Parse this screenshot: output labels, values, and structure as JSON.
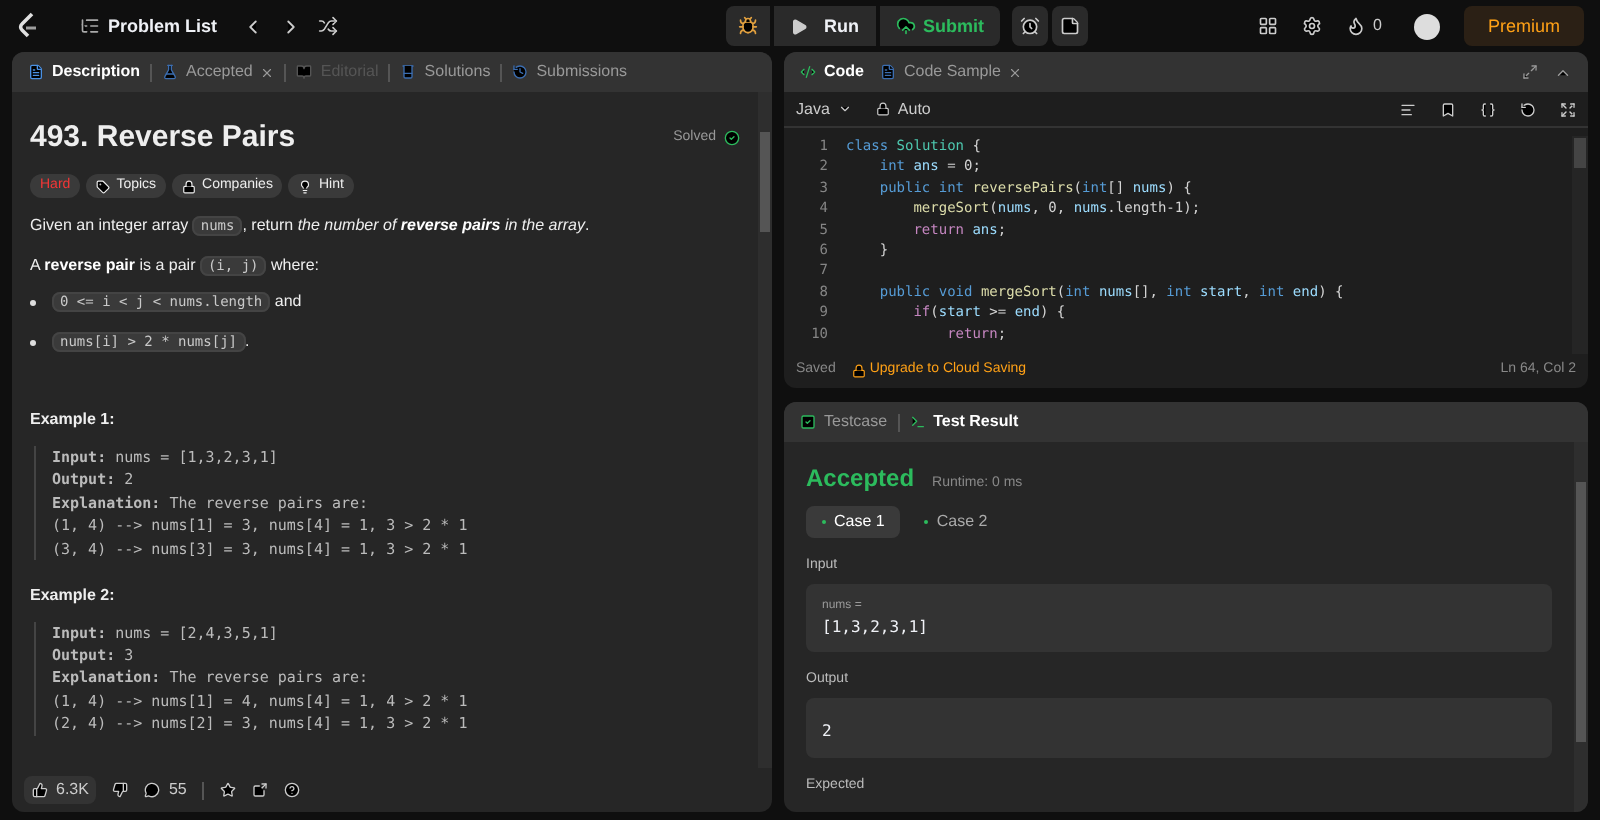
{
  "topbar": {
    "problem_list": "Problem List",
    "run": "Run",
    "submit": "Submit",
    "streak": "0",
    "premium": "Premium"
  },
  "description_panel": {
    "tabs": [
      {
        "label": "Description",
        "selected": true,
        "closable": false,
        "disabled": false
      },
      {
        "label": "Accepted",
        "selected": false,
        "closable": true,
        "disabled": false
      },
      {
        "label": "Editorial",
        "selected": false,
        "closable": false,
        "disabled": true
      },
      {
        "label": "Solutions",
        "selected": false,
        "closable": false,
        "disabled": false
      },
      {
        "label": "Submissions",
        "selected": false,
        "closable": false,
        "disabled": false
      }
    ],
    "title": "493. Reverse Pairs",
    "status": "Solved",
    "difficulty": "Hard",
    "chips": [
      "Topics",
      "Companies",
      "Hint"
    ],
    "paragraphs": [
      [
        {
          "kind": "text",
          "text": "Given an integer array "
        },
        {
          "kind": "code",
          "text": "nums"
        },
        {
          "kind": "text",
          "text": ", return "
        },
        {
          "kind": "italic",
          "text": "the number of "
        },
        {
          "kind": "bolditalic",
          "text": "reverse pairs"
        },
        {
          "kind": "italic",
          "text": " in the array"
        },
        {
          "kind": "text",
          "text": "."
        }
      ],
      [
        {
          "kind": "text",
          "text": "A "
        },
        {
          "kind": "bold",
          "text": "reverse pair"
        },
        {
          "kind": "text",
          "text": " is a pair "
        },
        {
          "kind": "code",
          "text": "(i, j)"
        },
        {
          "kind": "text",
          "text": " where:"
        }
      ]
    ],
    "bullets": [
      [
        {
          "kind": "code",
          "text": "0 <= i < j < nums.length"
        },
        {
          "kind": "text",
          "text": " and"
        }
      ],
      [
        {
          "kind": "code",
          "text": "nums[i] > 2 * nums[j]"
        },
        {
          "kind": "text",
          "text": "."
        }
      ]
    ],
    "examples": [
      {
        "title": "Example 1:",
        "lines": [
          "**Input:** nums = [1,3,2,3,1]",
          "**Output:** 2",
          "**Explanation:** The reverse pairs are:",
          "(1, 4) --> nums[1] = 3, nums[4] = 1, 3 > 2 * 1",
          "(3, 4) --> nums[3] = 3, nums[4] = 1, 3 > 2 * 1"
        ]
      },
      {
        "title": "Example 2:",
        "lines": [
          "**Input:** nums = [2,4,3,5,1]",
          "**Output:** 3",
          "**Explanation:** The reverse pairs are:",
          "(1, 4) --> nums[1] = 4, nums[4] = 1, 4 > 2 * 1",
          "(2, 4) --> nums[2] = 3, nums[4] = 1, 3 > 2 * 1"
        ]
      }
    ],
    "footer": {
      "likes": "6.3K",
      "comments": "55"
    }
  },
  "code_panel": {
    "tabs": [
      {
        "label": "Code",
        "selected": true,
        "closable": false
      },
      {
        "label": "Code Sample",
        "selected": false,
        "closable": true
      }
    ],
    "language": "Java",
    "mode": "Auto",
    "lines": [
      {
        "number": "1",
        "tokens": [
          {
            "kind": "type",
            "text": "class "
          },
          {
            "kind": "cls",
            "text": "Solution"
          },
          {
            "kind": "plain",
            "text": " {"
          }
        ]
      },
      {
        "number": "2",
        "tokens": [
          {
            "kind": "type",
            "text": "    int "
          },
          {
            "kind": "var",
            "text": "ans"
          },
          {
            "kind": "plain",
            "text": " = 0;"
          }
        ]
      },
      {
        "number": "3",
        "tokens": [
          {
            "kind": "type",
            "text": "    public int "
          },
          {
            "kind": "fn",
            "text": "reversePairs"
          },
          {
            "kind": "plain",
            "text": "("
          },
          {
            "kind": "type",
            "text": "int"
          },
          {
            "kind": "plain",
            "text": "[] "
          },
          {
            "kind": "var",
            "text": "nums"
          },
          {
            "kind": "plain",
            "text": ") {"
          }
        ]
      },
      {
        "number": "4",
        "tokens": [
          {
            "kind": "fn",
            "text": "        mergeSort"
          },
          {
            "kind": "plain",
            "text": "("
          },
          {
            "kind": "var",
            "text": "nums"
          },
          {
            "kind": "plain",
            "text": ", 0, "
          },
          {
            "kind": "var",
            "text": "nums"
          },
          {
            "kind": "plain",
            "text": ".length-1);"
          }
        ]
      },
      {
        "number": "5",
        "tokens": [
          {
            "kind": "kw",
            "text": "        return "
          },
          {
            "kind": "var",
            "text": "ans"
          },
          {
            "kind": "plain",
            "text": ";"
          }
        ]
      },
      {
        "number": "6",
        "tokens": [
          {
            "kind": "plain",
            "text": "    }"
          }
        ]
      },
      {
        "number": "7"
      },
      {
        "number": "8",
        "tokens": [
          {
            "kind": "type",
            "text": "    public void "
          },
          {
            "kind": "fn",
            "text": "mergeSort"
          },
          {
            "kind": "plain",
            "text": "("
          },
          {
            "kind": "type",
            "text": "int "
          },
          {
            "kind": "var",
            "text": "nums"
          },
          {
            "kind": "plain",
            "text": "[], "
          },
          {
            "kind": "type",
            "text": "int "
          },
          {
            "kind": "var",
            "text": "start"
          },
          {
            "kind": "plain",
            "text": ", "
          },
          {
            "kind": "type",
            "text": "int "
          },
          {
            "kind": "var",
            "text": "end"
          },
          {
            "kind": "plain",
            "text": ") {"
          }
        ]
      },
      {
        "number": "9",
        "tokens": [
          {
            "kind": "kw",
            "text": "        if"
          },
          {
            "kind": "plain",
            "text": "("
          },
          {
            "kind": "var",
            "text": "start"
          },
          {
            "kind": "plain",
            "text": " >= "
          },
          {
            "kind": "var",
            "text": "end"
          },
          {
            "kind": "plain",
            "text": ") {"
          }
        ]
      },
      {
        "number": "10",
        "tokens": [
          {
            "kind": "kw",
            "text": "            return"
          },
          {
            "kind": "plain",
            "text": ";"
          }
        ]
      }
    ],
    "saved": "Saved",
    "upgrade": "Upgrade to Cloud Saving",
    "cursor": "Ln 64, Col 2"
  },
  "test_panel": {
    "tabs": [
      {
        "label": "Testcase",
        "selected": false
      },
      {
        "label": "Test Result",
        "selected": true
      }
    ],
    "verdict": "Accepted",
    "runtime": "Runtime: 0 ms",
    "cases": [
      {
        "label": "Case 1",
        "selected": true
      },
      {
        "label": "Case 2",
        "selected": false
      }
    ],
    "input_label": "Input",
    "input_name": "nums =",
    "input_value": "[1,3,2,3,1]",
    "output_label": "Output",
    "output_value": "2",
    "expected_label": "Expected"
  }
}
